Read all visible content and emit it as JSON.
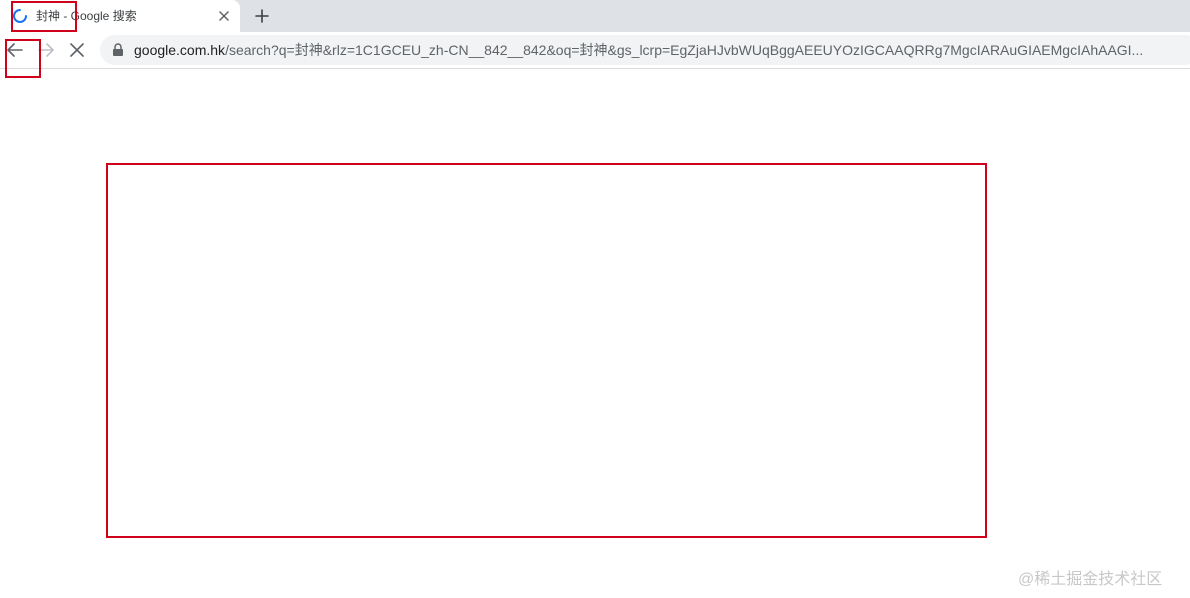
{
  "tab": {
    "title": "封神 - Google 搜索",
    "loading_icon": "loading-spinner-icon",
    "close_icon": "close-icon"
  },
  "new_tab_icon": "plus-icon",
  "toolbar": {
    "back_icon": "arrow-left-icon",
    "forward_icon": "arrow-right-icon",
    "stop_icon": "stop-x-icon"
  },
  "omnibox": {
    "lock_icon": "lock-icon",
    "url_host": "google.com.hk",
    "url_path": "/search?q=封神&rlz=1C1GCEU_zh-CN__842__842&oq=封神&gs_lcrp=EgZjaHJvbWUqBggAEEUYOzIGCAAQRRg7MgcIARAuGIAEMgcIAhAAGI..."
  },
  "annotation_color": "#d0021b",
  "watermark": "@稀土掘金技术社区"
}
